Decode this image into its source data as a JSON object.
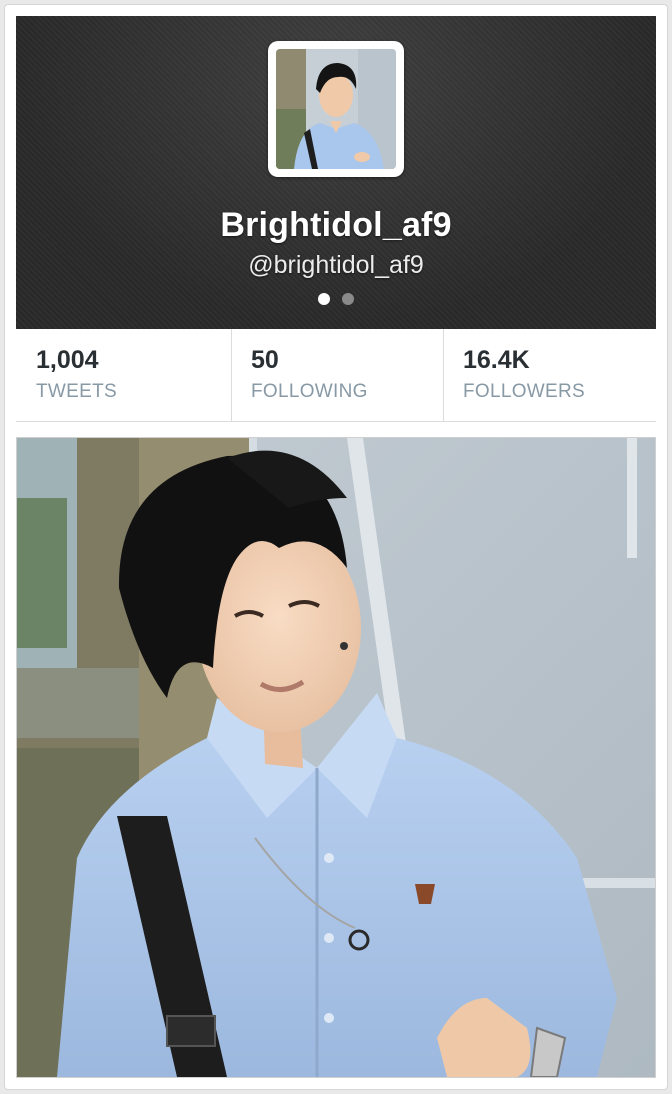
{
  "profile": {
    "display_name": "Brightidol_af9",
    "handle": "@brightidol_af9"
  },
  "pager": {
    "page_count": 2,
    "active_page": 1
  },
  "stats": [
    {
      "value": "1,004",
      "label": "TWEETS"
    },
    {
      "value": "50",
      "label": "FOLLOWING"
    },
    {
      "value": "16.4K",
      "label": "FOLLOWERS"
    }
  ],
  "colors": {
    "header_bg": "#2a2a2a",
    "stat_value": "#292f33",
    "stat_label": "#8899a6",
    "shirt": "#a9c6ec"
  },
  "icons": {
    "avatar": "profile-avatar-photo",
    "photo": "profile-media-photo"
  }
}
